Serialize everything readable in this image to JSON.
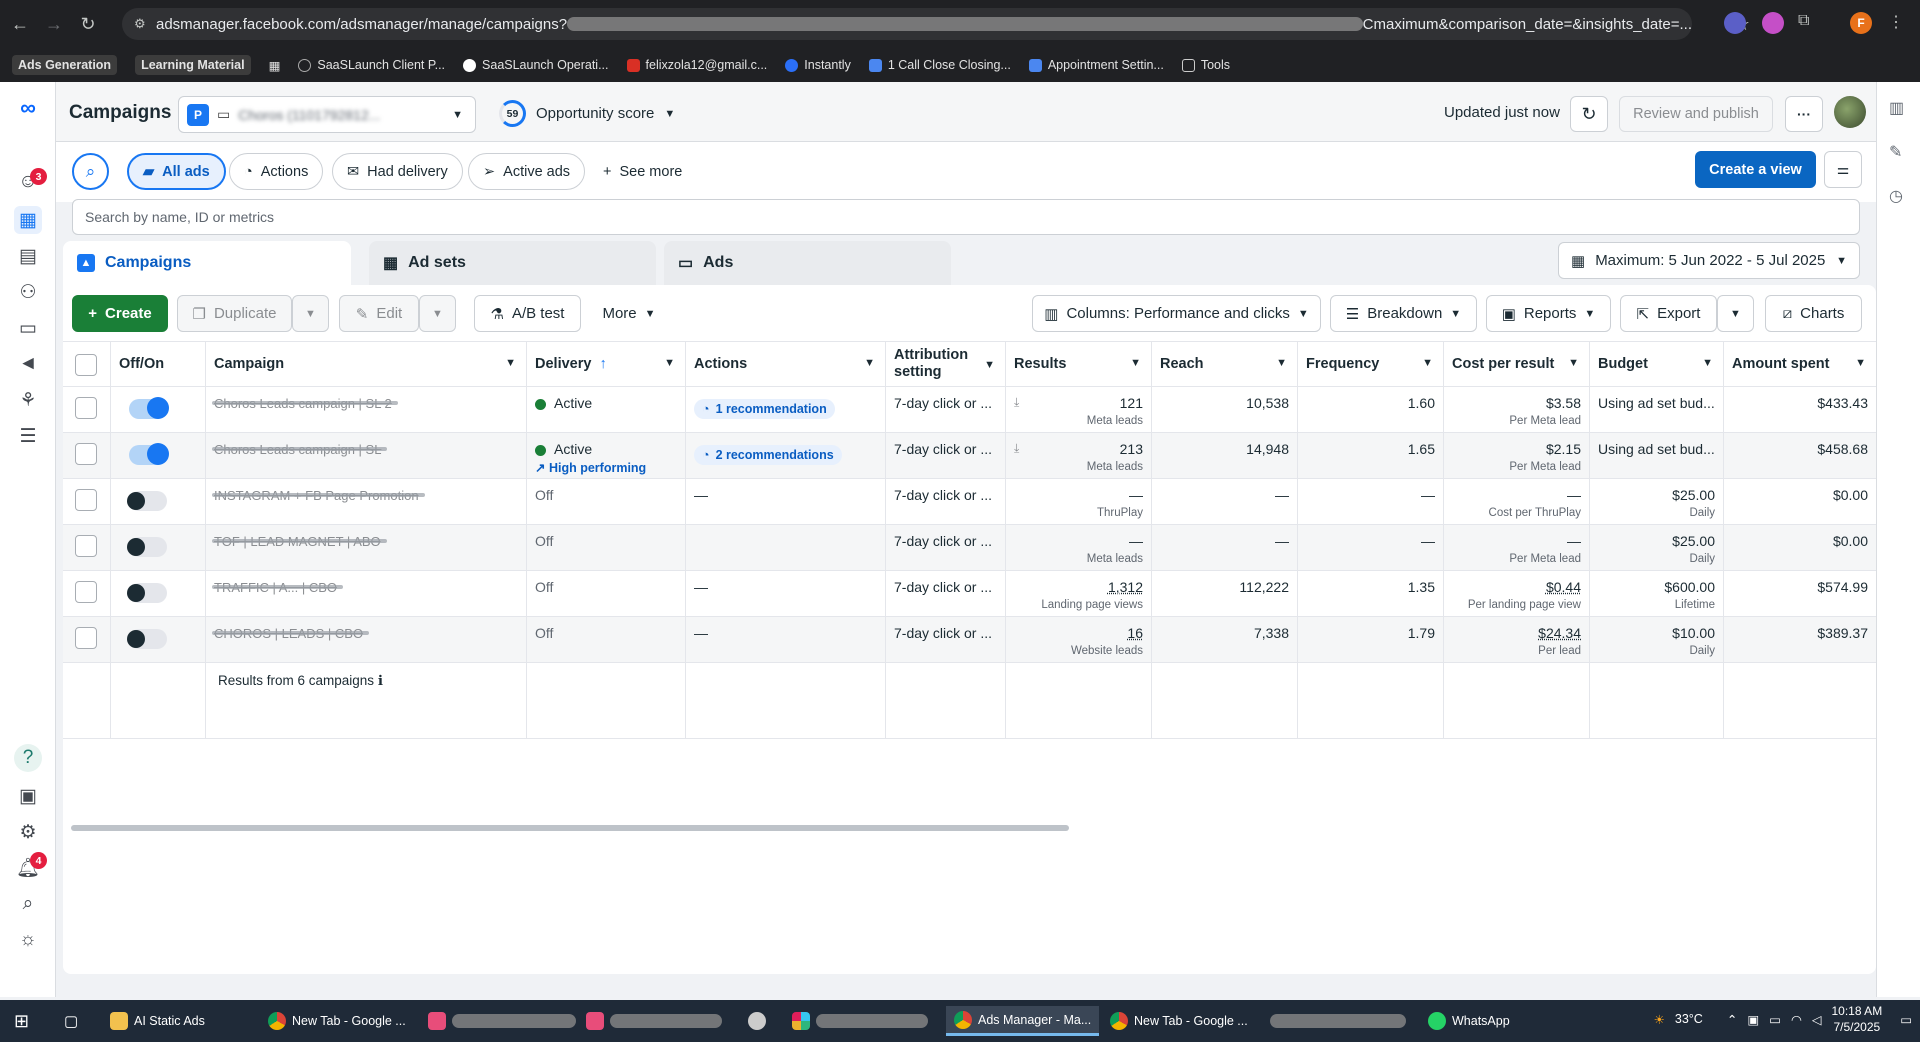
{
  "browser": {
    "url_prefix": "adsmanager.facebook.com/adsmanager/manage/campaigns?",
    "url_suffix": "Cmaximum&comparison_date=&insights_date=...",
    "profile_initial": "F"
  },
  "bookmarks": [
    {
      "label": "Ads Generation"
    },
    {
      "label": "Learning Material"
    },
    {
      "label": "SaaSLaunch Client P..."
    },
    {
      "label": "SaaSLaunch Operati..."
    },
    {
      "label": "felixzola12@gmail.c..."
    },
    {
      "label": "Instantly"
    },
    {
      "label": "1 Call Close Closing..."
    },
    {
      "label": "Appointment Settin..."
    },
    {
      "label": "Tools"
    }
  ],
  "rail": {
    "notif_badge": "3",
    "alerts_badge": "4",
    "help": "?"
  },
  "header": {
    "title": "Campaigns",
    "account_initial": "P",
    "account_name": "Choros (1101792812... ",
    "opportunity_score": "59",
    "opportunity_label": "Opportunity score",
    "updated": "Updated just now",
    "review_publish": "Review and publish",
    "more": "···"
  },
  "filters": {
    "chips": [
      "All ads",
      "Actions",
      "Had delivery",
      "Active ads",
      "See more"
    ],
    "create_view": "Create a view",
    "search_placeholder": "Search by name, ID or metrics"
  },
  "tabs": [
    "Campaigns",
    "Ad sets",
    "Ads"
  ],
  "date_range": "Maximum: 5 Jun 2022 - 5 Jul 2025",
  "toolbar": {
    "create": "Create",
    "duplicate": "Duplicate",
    "edit": "Edit",
    "ab_test": "A/B test",
    "more": "More",
    "columns": "Columns: Performance and clicks",
    "breakdown": "Breakdown",
    "reports": "Reports",
    "export": "Export",
    "charts": "Charts"
  },
  "table": {
    "headers": [
      "Off/On",
      "Campaign",
      "Delivery",
      "Actions",
      "Attribution setting",
      "Results",
      "Reach",
      "Frequency",
      "Cost per result",
      "Budget",
      "Amount spent"
    ],
    "rows": [
      {
        "on": true,
        "campaign": "Choros Leads campaign | SL 2",
        "delivery": "Active",
        "delivery_sub": "",
        "actions": "1 recommendation",
        "attribution": "7-day click or ...",
        "results": "121",
        "results_sub": "Meta leads",
        "reach": "10,538",
        "frequency": "1.60",
        "cpr": "$3.58",
        "cpr_sub": "Per Meta lead",
        "budget": "Using ad set bud...",
        "budget_sub": "",
        "spent": "$433.43"
      },
      {
        "on": true,
        "campaign": "Choros Leads campaign | SL",
        "delivery": "Active",
        "delivery_sub": "High performing",
        "actions": "2 recommendations",
        "attribution": "7-day click or ...",
        "results": "213",
        "results_sub": "Meta leads",
        "reach": "14,948",
        "frequency": "1.65",
        "cpr": "$2.15",
        "cpr_sub": "Per Meta lead",
        "budget": "Using ad set bud...",
        "budget_sub": "",
        "spent": "$458.68"
      },
      {
        "on": false,
        "campaign": "INSTAGRAM + FB Page Promotion",
        "delivery": "Off",
        "delivery_sub": "",
        "actions": "—",
        "attribution": "7-day click or ...",
        "results": "—",
        "results_sub": "ThruPlay",
        "reach": "—",
        "frequency": "—",
        "cpr": "—",
        "cpr_sub": "Cost per ThruPlay",
        "budget": "$25.00",
        "budget_sub": "Daily",
        "spent": "$0.00"
      },
      {
        "on": false,
        "campaign": "TOF | LEAD MAGNET | ABO",
        "delivery": "Off",
        "delivery_sub": "",
        "actions": "",
        "attribution": "7-day click or ...",
        "results": "—",
        "results_sub": "Meta leads",
        "reach": "—",
        "frequency": "—",
        "cpr": "—",
        "cpr_sub": "Per Meta lead",
        "budget": "$25.00",
        "budget_sub": "Daily",
        "spent": "$0.00"
      },
      {
        "on": false,
        "campaign": "TRAFFIC | A... | CBO",
        "delivery": "Off",
        "delivery_sub": "",
        "actions": "—",
        "attribution": "7-day click or ...",
        "results": "1,312",
        "results_sub": "Landing page views",
        "reach": "112,222",
        "frequency": "1.35",
        "cpr": "$0.44",
        "cpr_sub": "Per landing page view",
        "budget": "$600.00",
        "budget_sub": "Lifetime",
        "spent": "$574.99"
      },
      {
        "on": false,
        "campaign": "CHOROS | LEADS | CBO",
        "delivery": "Off",
        "delivery_sub": "",
        "actions": "—",
        "attribution": "7-day click or ...",
        "results": "16",
        "results_sub": "Website leads",
        "reach": "7,338",
        "frequency": "1.79",
        "cpr": "$24.34",
        "cpr_sub": "Per lead",
        "budget": "$10.00",
        "budget_sub": "Daily",
        "spent": "$389.37"
      }
    ],
    "footer": "Results from 6 campaigns"
  },
  "taskbar": {
    "items": [
      "AI Static Ads",
      "New Tab - Google ...",
      "Ads Manager - Ma...",
      "New Tab - Google ...",
      "WhatsApp"
    ],
    "temp": "33°C",
    "time": "10:18 AM",
    "date": "7/5/2025"
  },
  "colors": {
    "accent": "#1877f2",
    "create_green": "#1a7f37",
    "active_dot": "#1a7f37"
  }
}
